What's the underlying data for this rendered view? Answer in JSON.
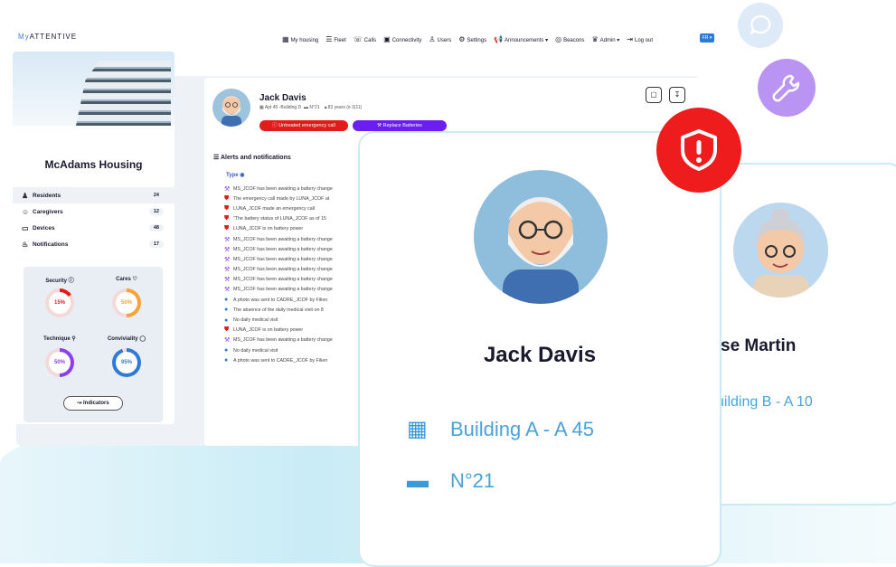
{
  "app": {
    "logo_prefix": "My",
    "logo_suffix": "ATTENTIVE",
    "lang": "FR ▾"
  },
  "nav": {
    "items": [
      {
        "icon": "▦",
        "label": "My housing"
      },
      {
        "icon": "☰",
        "label": "Fleet"
      },
      {
        "icon": "☏",
        "label": "Calls"
      },
      {
        "icon": "▣",
        "label": "Connectivity"
      },
      {
        "icon": "♙",
        "label": "Users"
      },
      {
        "icon": "⚙",
        "label": "Settings"
      },
      {
        "icon": "📢",
        "label": "Announcements ▾"
      },
      {
        "icon": "◎",
        "label": "Beacons"
      },
      {
        "icon": "♛",
        "label": "Admin ▾"
      },
      {
        "icon": "⇥",
        "label": "Log out"
      }
    ]
  },
  "sidebar": {
    "house_name": "McAdams Housing",
    "items": [
      {
        "label": "Residents",
        "count": "24"
      },
      {
        "label": "Caregivers",
        "count": "12"
      },
      {
        "label": "Devices",
        "count": "48"
      },
      {
        "label": "Notifications",
        "count": "17"
      }
    ],
    "indicators": [
      {
        "label": "Security",
        "icon": "ⓘ",
        "value": "15%",
        "pct": 15,
        "color": "#e21b1b"
      },
      {
        "label": "Cares",
        "icon": "♡",
        "value": "50%",
        "pct": 50,
        "color": "#f5a23a"
      },
      {
        "label": "Technique",
        "icon": "⚲",
        "value": "50%",
        "pct": 50,
        "color": "#8a3ff2"
      },
      {
        "label": "Conviviality",
        "icon": "◯",
        "value": "95%",
        "pct": 95,
        "color": "#2f7ad9"
      }
    ],
    "indicators_button": "Indicators"
  },
  "resident": {
    "name": "Jack Davis",
    "apt": "Apt 45 -Building D",
    "bed": "N°21",
    "age": "83 years (e 3(11)",
    "tag_emergency": "Untreated emergency call",
    "tag_batteries": "Replace Batteries"
  },
  "alerts_section": {
    "title": "Alerts and notifications",
    "type_label": "Type",
    "items": [
      {
        "kind": "purple",
        "text": "MS_JCOF has been awaiting a battery change"
      },
      {
        "kind": "red",
        "text": "The emergency call made by LUNA_JCOF at"
      },
      {
        "kind": "red",
        "text": "LUNA_JCOF made an emergency call"
      },
      {
        "kind": "red",
        "text": "\"The battery status of LUNA_JCOF as of 15"
      },
      {
        "kind": "red",
        "text": "LUNA_JCOF is on battery power"
      },
      {
        "kind": "purple",
        "text": "MS_JCOF has been awaiting a battery change"
      },
      {
        "kind": "purple",
        "text": "MS_JCOF has been awaiting a battery change"
      },
      {
        "kind": "purple",
        "text": "MS_JCOF has been awaiting a battery change"
      },
      {
        "kind": "purple",
        "text": "MS_JCOF has been awaiting a battery change"
      },
      {
        "kind": "purple",
        "text": "MS_JCOF has been awaiting a battery change"
      },
      {
        "kind": "purple",
        "text": "MS_JCOF has been awaiting a battery change"
      },
      {
        "kind": "blue",
        "text": "A photo was sent to CADRE_JCOF by Filien"
      },
      {
        "kind": "blue",
        "text": "The absence of the daily medical visit on 8"
      },
      {
        "kind": "blue",
        "text": "No daily medical visit"
      },
      {
        "kind": "red",
        "text": "LUNA_JCOF is on battery power"
      },
      {
        "kind": "purple",
        "text": "MS_JCOF has been awaiting a battery change"
      },
      {
        "kind": "blue",
        "text": "No daily medical visit"
      },
      {
        "kind": "blue",
        "text": "A photo was sent to CADRE_JCOF by Filien"
      }
    ]
  },
  "card_front": {
    "name": "Jack Davis",
    "building": "Building A - A 45",
    "bed": "N°21"
  },
  "card_back": {
    "name": "se Martin",
    "building": "uilding B - A 10"
  }
}
